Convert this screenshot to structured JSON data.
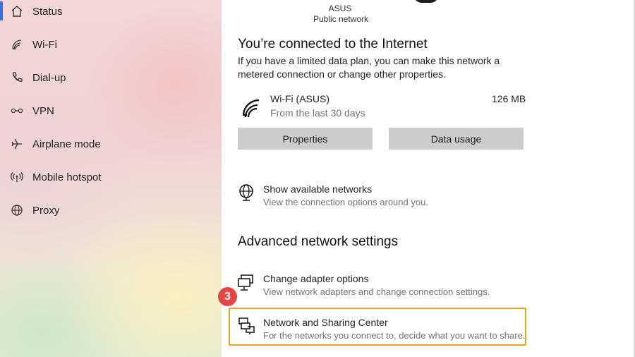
{
  "sidebar": {
    "items": [
      {
        "label": "Status",
        "icon": "home-icon",
        "active": true
      },
      {
        "label": "Wi-Fi",
        "icon": "wifi-icon"
      },
      {
        "label": "Dial-up",
        "icon": "phone-icon"
      },
      {
        "label": "VPN",
        "icon": "vpn-icon"
      },
      {
        "label": "Airplane mode",
        "icon": "airplane-icon"
      },
      {
        "label": "Mobile hotspot",
        "icon": "hotspot-icon"
      },
      {
        "label": "Proxy",
        "icon": "globe-icon"
      }
    ],
    "accent_color": "#3a6fd8"
  },
  "network": {
    "name": "ASUS",
    "type": "Public network"
  },
  "connection": {
    "heading": "You’re connected to the Internet",
    "description_line1": "If you have a limited data plan, you can make this network a",
    "description_line2": "metered connection or change other properties.",
    "adapter_name": "Wi-Fi (ASUS)",
    "usage_period": "From the last 30 days",
    "usage_amount": "126 MB"
  },
  "buttons": {
    "properties": "Properties",
    "data_usage": "Data usage"
  },
  "show_networks": {
    "title": "Show available networks",
    "subtitle": "View the connection options around you."
  },
  "advanced": {
    "heading": "Advanced network settings",
    "adapter_options_title": "Change adapter options",
    "adapter_options_subtitle": "View network adapters and change connection settings.",
    "sharing_center_title": "Network and Sharing Center",
    "sharing_center_subtitle": "For the networks you connect to, decide what you want to share."
  },
  "annotation": {
    "step_number": "3",
    "highlight_color": "#e8a420",
    "badge_color": "#e84444"
  }
}
